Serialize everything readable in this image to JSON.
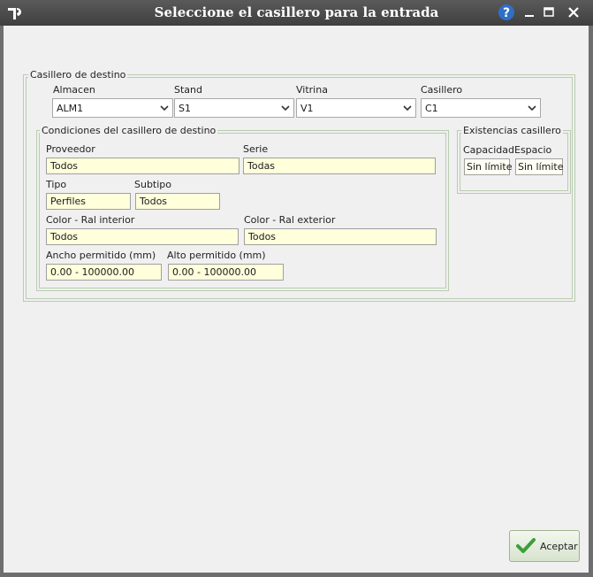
{
  "window": {
    "title": "Seleccione el casillero para la entrada"
  },
  "destino": {
    "legend": "Casillero de destino",
    "almacen": {
      "label": "Almacen",
      "value": "ALM1"
    },
    "stand": {
      "label": "Stand",
      "value": "S1"
    },
    "vitrina": {
      "label": "Vitrina",
      "value": "V1"
    },
    "casillero": {
      "label": "Casillero",
      "value": "C1"
    }
  },
  "condiciones": {
    "legend": "Condiciones del casillero de destino",
    "proveedor": {
      "label": "Proveedor",
      "value": "Todos"
    },
    "serie": {
      "label": "Serie",
      "value": "Todas"
    },
    "tipo": {
      "label": "Tipo",
      "value": "Perfiles"
    },
    "subtipo": {
      "label": "Subtipo",
      "value": "Todos"
    },
    "color_interior": {
      "label": "Color - Ral  interior",
      "value": "Todos"
    },
    "color_exterior": {
      "label": "Color - Ral  exterior",
      "value": "Todos"
    },
    "ancho": {
      "label": "Ancho permitido (mm)",
      "value": "0.00 - 100000.00"
    },
    "alto": {
      "label": "Alto permitido (mm)",
      "value": "0.00 - 100000.00"
    }
  },
  "existencias": {
    "legend": "Existencias casillero",
    "capacidad": {
      "label": "Capacidad",
      "value": "Sin límite"
    },
    "espacio": {
      "label": "Espacio",
      "value": "Sin límite"
    }
  },
  "footer": {
    "accept_label": "Aceptar"
  },
  "colors": {
    "field_bg": "#ffffdc",
    "group_border": "#b8ccb0",
    "accept_check": "#3aa03a"
  }
}
